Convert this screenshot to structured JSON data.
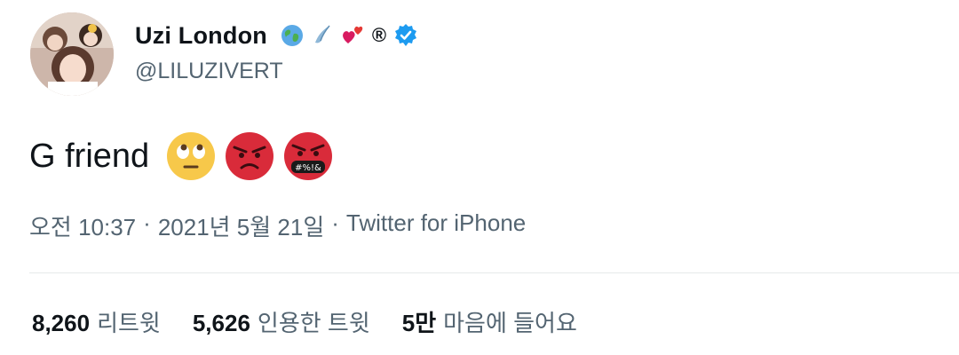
{
  "profile": {
    "display_name": "Uzi London",
    "handle": "@LILUZIVERT",
    "name_icons": [
      "globe-icon",
      "comet-icon",
      "hearts-icon",
      "registered-icon",
      "verified-badge-icon"
    ],
    "registered_symbol": "®"
  },
  "tweet": {
    "text": "G friend",
    "emojis": [
      "face-with-rolling-eyes-emoji",
      "pouting-face-emoji",
      "face-with-symbols-on-mouth-emoji"
    ]
  },
  "meta": {
    "time": "오전 10:37",
    "sep1": "·",
    "date": "2021년 5월 21일",
    "sep2": "·",
    "source": "Twitter for iPhone"
  },
  "stats": [
    {
      "count": "8,260",
      "label": "리트윗"
    },
    {
      "count": "5,626",
      "label": "인용한 트윗"
    },
    {
      "count": "5만",
      "label": "마음에 들어요"
    }
  ],
  "colors": {
    "verified": "#1d9bf0",
    "secondary_text": "#536471",
    "divider": "#e6e9ea"
  }
}
